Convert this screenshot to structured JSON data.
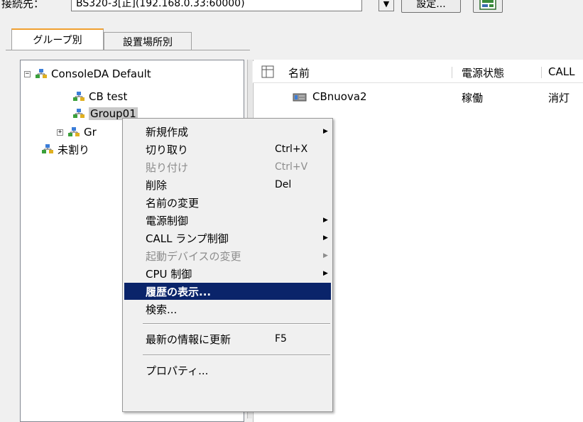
{
  "connection": {
    "label": "接続先：",
    "value": "BS320-3[正](192.168.0.33:60000)",
    "settings_label": "設定..."
  },
  "tabs": [
    {
      "label": "グループ別"
    },
    {
      "label": "設置場所別"
    }
  ],
  "tree": {
    "root": "ConsoleDA Default",
    "items": [
      "CB test",
      "Group01",
      "Gr",
      "未割り"
    ]
  },
  "list": {
    "headers": [
      "名前",
      "電源状態",
      "CALL"
    ],
    "rows": [
      {
        "name": "CBnuova2",
        "power": "稼働",
        "call": "消灯"
      }
    ]
  },
  "context_menu": {
    "items": [
      {
        "label": "新規作成",
        "shortcut": "",
        "submenu": true,
        "disabled": false
      },
      {
        "label": "切り取り",
        "shortcut": "Ctrl+X",
        "submenu": false,
        "disabled": false
      },
      {
        "label": "貼り付け",
        "shortcut": "Ctrl+V",
        "submenu": false,
        "disabled": true
      },
      {
        "label": "削除",
        "shortcut": "Del",
        "submenu": false,
        "disabled": false
      },
      {
        "label": "名前の変更",
        "shortcut": "",
        "submenu": false,
        "disabled": false
      },
      {
        "label": "電源制御",
        "shortcut": "",
        "submenu": true,
        "disabled": false
      },
      {
        "label": "CALL ランプ制御",
        "shortcut": "",
        "submenu": true,
        "disabled": false
      },
      {
        "label": "起動デバイスの変更",
        "shortcut": "",
        "submenu": true,
        "disabled": true
      },
      {
        "label": "CPU 制御",
        "shortcut": "",
        "submenu": true,
        "disabled": false
      },
      {
        "label": "履歴の表示...",
        "shortcut": "",
        "submenu": false,
        "disabled": false,
        "highlighted": true
      },
      {
        "label": "検索...",
        "shortcut": "",
        "submenu": false,
        "disabled": false
      },
      {
        "label": "最新の情報に更新",
        "shortcut": "F5",
        "submenu": false,
        "disabled": false
      },
      {
        "label": "プロパティ...",
        "shortcut": "",
        "submenu": false,
        "disabled": false
      }
    ],
    "submenu_arrow": "▶"
  },
  "colors": {
    "highlight": "#0a246a",
    "tab_accent": "#f0a030"
  },
  "icons": {
    "tree_expander_minus": "⊟",
    "tree_expander_plus": "⊞",
    "dropdown": "▼"
  }
}
